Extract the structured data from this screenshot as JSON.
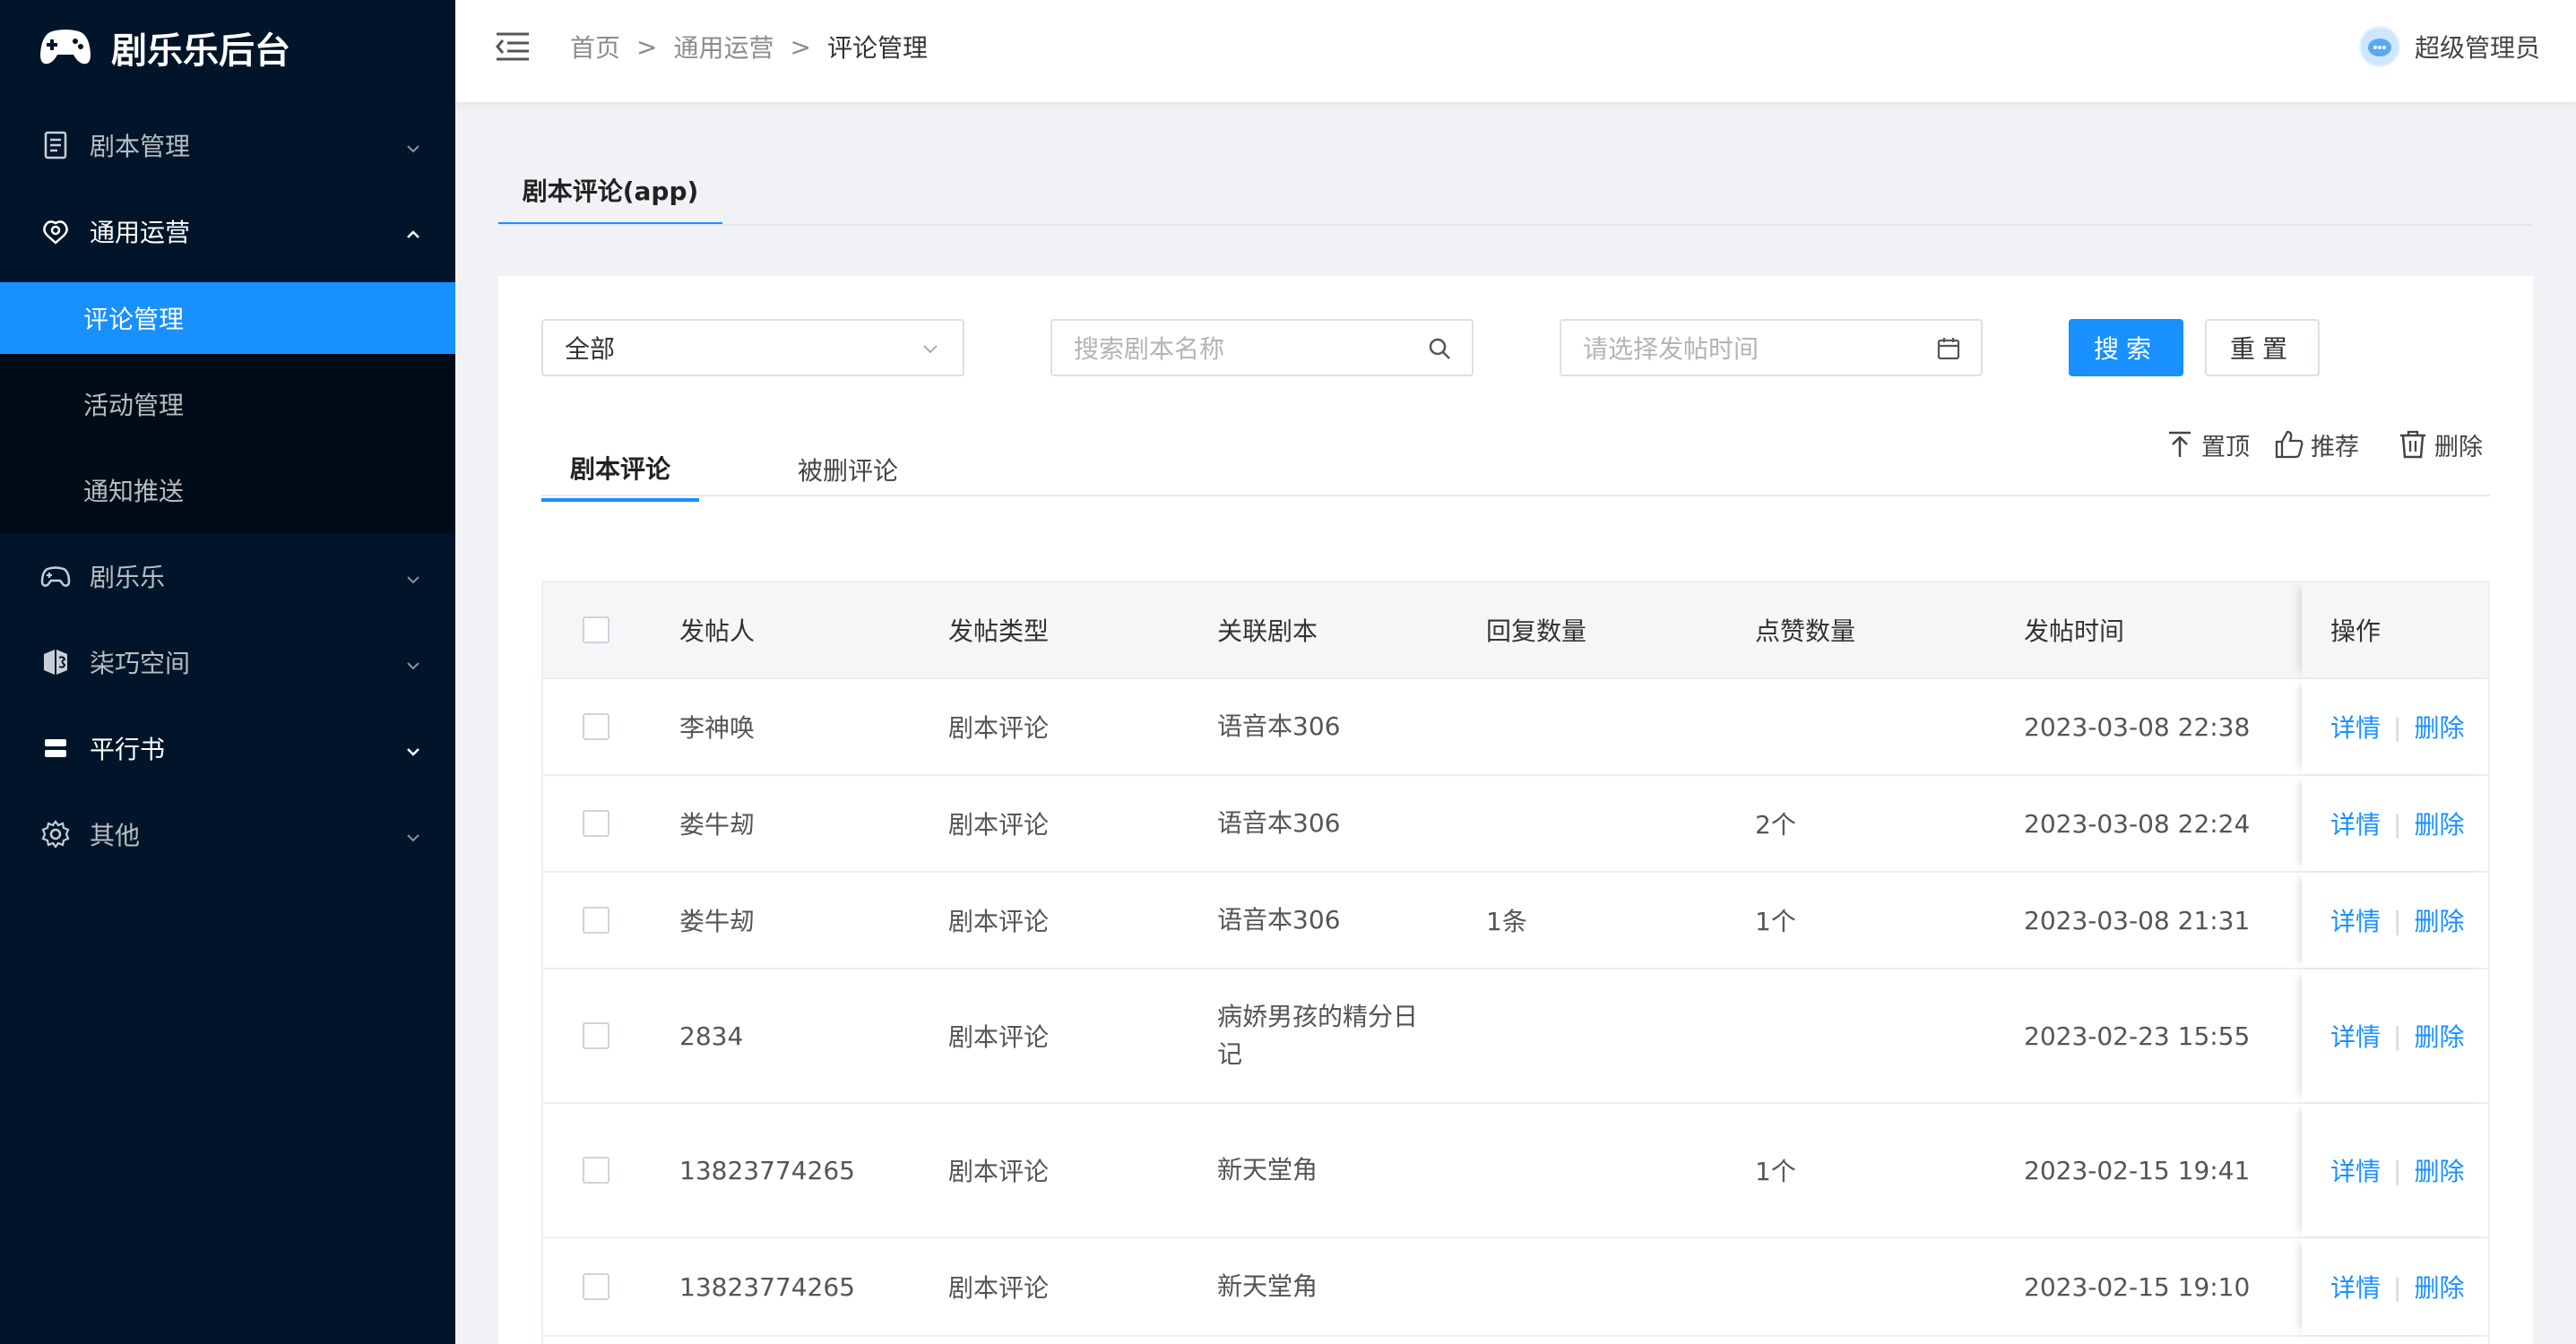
{
  "app": {
    "title": "剧乐乐后台"
  },
  "sidebar": {
    "items": [
      {
        "label": "剧本管理",
        "icon": "document-list-icon"
      },
      {
        "label": "通用运营",
        "icon": "tools-icon"
      },
      {
        "label": "剧乐乐",
        "icon": "gamepad-icon"
      },
      {
        "label": "柒巧空间",
        "icon": "cube-icon"
      },
      {
        "label": "平行书",
        "icon": "layers-icon"
      },
      {
        "label": "其他",
        "icon": "gear-icon"
      }
    ],
    "subitems": [
      {
        "label": "评论管理"
      },
      {
        "label": "活动管理"
      },
      {
        "label": "通知推送"
      }
    ]
  },
  "header": {
    "breadcrumb": [
      "首页",
      "通用运营",
      "评论管理"
    ],
    "separator": ">",
    "user": "超级管理员"
  },
  "page_tab": "剧本评论(app)",
  "filters": {
    "type_value": "全部",
    "search_placeholder": "搜索剧本名称",
    "date_placeholder": "请选择发帖时间",
    "search_button": "搜索",
    "reset_button": "重置"
  },
  "tabs": [
    "剧本评论",
    "被删评论"
  ],
  "toolbar": {
    "pin": "置顶",
    "recommend": "推荐",
    "delete": "删除"
  },
  "table": {
    "columns": [
      "发帖人",
      "发帖类型",
      "关联剧本",
      "回复数量",
      "点赞数量",
      "发帖时间",
      "操作"
    ],
    "actions": {
      "detail": "详情",
      "delete": "删除",
      "sep": "|"
    },
    "rows": [
      {
        "poster": "李神唤",
        "type": "剧本评论",
        "script": "语音本306",
        "replies": "",
        "likes": "",
        "time": "2023-03-08 22:38"
      },
      {
        "poster": "娄牛刼",
        "type": "剧本评论",
        "script": "语音本306",
        "replies": "",
        "likes": "2个",
        "time": "2023-03-08 22:24"
      },
      {
        "poster": "娄牛刼",
        "type": "剧本评论",
        "script": "语音本306",
        "replies": "1条",
        "likes": "1个",
        "time": "2023-03-08 21:31"
      },
      {
        "poster": "2834",
        "type": "剧本评论",
        "script": "病娇男孩的精分日记",
        "replies": "",
        "likes": "",
        "time": "2023-02-23 15:55"
      },
      {
        "poster": "13823774265",
        "type": "剧本评论",
        "script": "新天堂角",
        "replies": "",
        "likes": "1个",
        "time": "2023-02-15 19:41"
      },
      {
        "poster": "13823774265",
        "type": "剧本评论",
        "script": "新天堂角",
        "replies": "",
        "likes": "",
        "time": "2023-02-15 19:10"
      }
    ]
  },
  "colors": {
    "primary": "#1890ff",
    "sidebar": "#001529",
    "submenu": "#000c17"
  }
}
